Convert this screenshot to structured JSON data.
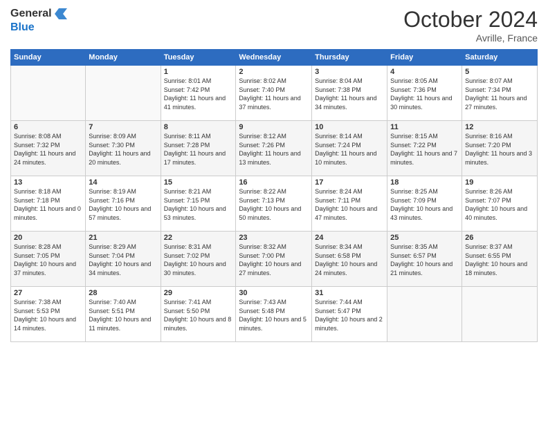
{
  "logo": {
    "line1": "General",
    "line2": "Blue"
  },
  "title": "October 2024",
  "location": "Avrille, France",
  "weekdays": [
    "Sunday",
    "Monday",
    "Tuesday",
    "Wednesday",
    "Thursday",
    "Friday",
    "Saturday"
  ],
  "weeks": [
    [
      {
        "day": "",
        "info": ""
      },
      {
        "day": "",
        "info": ""
      },
      {
        "day": "1",
        "info": "Sunrise: 8:01 AM\nSunset: 7:42 PM\nDaylight: 11 hours and 41 minutes."
      },
      {
        "day": "2",
        "info": "Sunrise: 8:02 AM\nSunset: 7:40 PM\nDaylight: 11 hours and 37 minutes."
      },
      {
        "day": "3",
        "info": "Sunrise: 8:04 AM\nSunset: 7:38 PM\nDaylight: 11 hours and 34 minutes."
      },
      {
        "day": "4",
        "info": "Sunrise: 8:05 AM\nSunset: 7:36 PM\nDaylight: 11 hours and 30 minutes."
      },
      {
        "day": "5",
        "info": "Sunrise: 8:07 AM\nSunset: 7:34 PM\nDaylight: 11 hours and 27 minutes."
      }
    ],
    [
      {
        "day": "6",
        "info": "Sunrise: 8:08 AM\nSunset: 7:32 PM\nDaylight: 11 hours and 24 minutes."
      },
      {
        "day": "7",
        "info": "Sunrise: 8:09 AM\nSunset: 7:30 PM\nDaylight: 11 hours and 20 minutes."
      },
      {
        "day": "8",
        "info": "Sunrise: 8:11 AM\nSunset: 7:28 PM\nDaylight: 11 hours and 17 minutes."
      },
      {
        "day": "9",
        "info": "Sunrise: 8:12 AM\nSunset: 7:26 PM\nDaylight: 11 hours and 13 minutes."
      },
      {
        "day": "10",
        "info": "Sunrise: 8:14 AM\nSunset: 7:24 PM\nDaylight: 11 hours and 10 minutes."
      },
      {
        "day": "11",
        "info": "Sunrise: 8:15 AM\nSunset: 7:22 PM\nDaylight: 11 hours and 7 minutes."
      },
      {
        "day": "12",
        "info": "Sunrise: 8:16 AM\nSunset: 7:20 PM\nDaylight: 11 hours and 3 minutes."
      }
    ],
    [
      {
        "day": "13",
        "info": "Sunrise: 8:18 AM\nSunset: 7:18 PM\nDaylight: 11 hours and 0 minutes."
      },
      {
        "day": "14",
        "info": "Sunrise: 8:19 AM\nSunset: 7:16 PM\nDaylight: 10 hours and 57 minutes."
      },
      {
        "day": "15",
        "info": "Sunrise: 8:21 AM\nSunset: 7:15 PM\nDaylight: 10 hours and 53 minutes."
      },
      {
        "day": "16",
        "info": "Sunrise: 8:22 AM\nSunset: 7:13 PM\nDaylight: 10 hours and 50 minutes."
      },
      {
        "day": "17",
        "info": "Sunrise: 8:24 AM\nSunset: 7:11 PM\nDaylight: 10 hours and 47 minutes."
      },
      {
        "day": "18",
        "info": "Sunrise: 8:25 AM\nSunset: 7:09 PM\nDaylight: 10 hours and 43 minutes."
      },
      {
        "day": "19",
        "info": "Sunrise: 8:26 AM\nSunset: 7:07 PM\nDaylight: 10 hours and 40 minutes."
      }
    ],
    [
      {
        "day": "20",
        "info": "Sunrise: 8:28 AM\nSunset: 7:05 PM\nDaylight: 10 hours and 37 minutes."
      },
      {
        "day": "21",
        "info": "Sunrise: 8:29 AM\nSunset: 7:04 PM\nDaylight: 10 hours and 34 minutes."
      },
      {
        "day": "22",
        "info": "Sunrise: 8:31 AM\nSunset: 7:02 PM\nDaylight: 10 hours and 30 minutes."
      },
      {
        "day": "23",
        "info": "Sunrise: 8:32 AM\nSunset: 7:00 PM\nDaylight: 10 hours and 27 minutes."
      },
      {
        "day": "24",
        "info": "Sunrise: 8:34 AM\nSunset: 6:58 PM\nDaylight: 10 hours and 24 minutes."
      },
      {
        "day": "25",
        "info": "Sunrise: 8:35 AM\nSunset: 6:57 PM\nDaylight: 10 hours and 21 minutes."
      },
      {
        "day": "26",
        "info": "Sunrise: 8:37 AM\nSunset: 6:55 PM\nDaylight: 10 hours and 18 minutes."
      }
    ],
    [
      {
        "day": "27",
        "info": "Sunrise: 7:38 AM\nSunset: 5:53 PM\nDaylight: 10 hours and 14 minutes."
      },
      {
        "day": "28",
        "info": "Sunrise: 7:40 AM\nSunset: 5:51 PM\nDaylight: 10 hours and 11 minutes."
      },
      {
        "day": "29",
        "info": "Sunrise: 7:41 AM\nSunset: 5:50 PM\nDaylight: 10 hours and 8 minutes."
      },
      {
        "day": "30",
        "info": "Sunrise: 7:43 AM\nSunset: 5:48 PM\nDaylight: 10 hours and 5 minutes."
      },
      {
        "day": "31",
        "info": "Sunrise: 7:44 AM\nSunset: 5:47 PM\nDaylight: 10 hours and 2 minutes."
      },
      {
        "day": "",
        "info": ""
      },
      {
        "day": "",
        "info": ""
      }
    ]
  ]
}
